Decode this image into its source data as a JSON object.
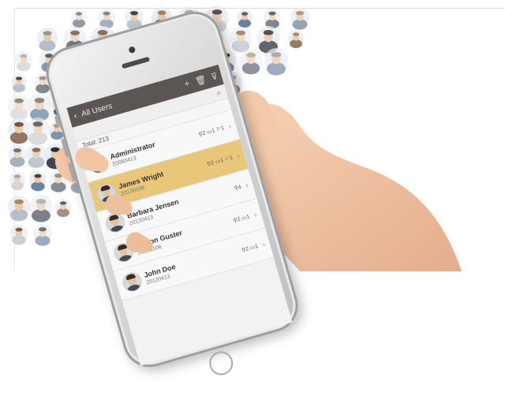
{
  "app": {
    "title": "All Users",
    "back_symbol": "‹",
    "add_symbol": "+",
    "delete_symbol": "🗑",
    "filter_symbol": "⊽",
    "search_symbol": "⌕",
    "total_label": "Total: 213"
  },
  "users": [
    {
      "name": "Administrator",
      "date": "20080413",
      "stats": "⚲2 ▭1 ⚐1",
      "selected": false
    },
    {
      "name": "James Wright",
      "date": "20130106",
      "stats": "⚲2 ▭1 ⚐1",
      "selected": true
    },
    {
      "name": "Barbara Jensen",
      "date": "20120413",
      "stats": "⚲4",
      "selected": false
    },
    {
      "name": "Burton Guster",
      "date": "20130106",
      "stats": "⚲2 ▭1",
      "selected": false
    },
    {
      "name": "John Doe",
      "date": "20120413",
      "stats": "⚲2 ▭1",
      "selected": false
    }
  ],
  "colors": {
    "app_bar": "#5b5654",
    "selected_row": "#e8c77b",
    "skin": "#f1c9a8"
  },
  "icons": [
    "back-arrow-icon",
    "add-icon",
    "trash-icon",
    "filter-icon",
    "search-icon",
    "chevron-right-icon"
  ]
}
